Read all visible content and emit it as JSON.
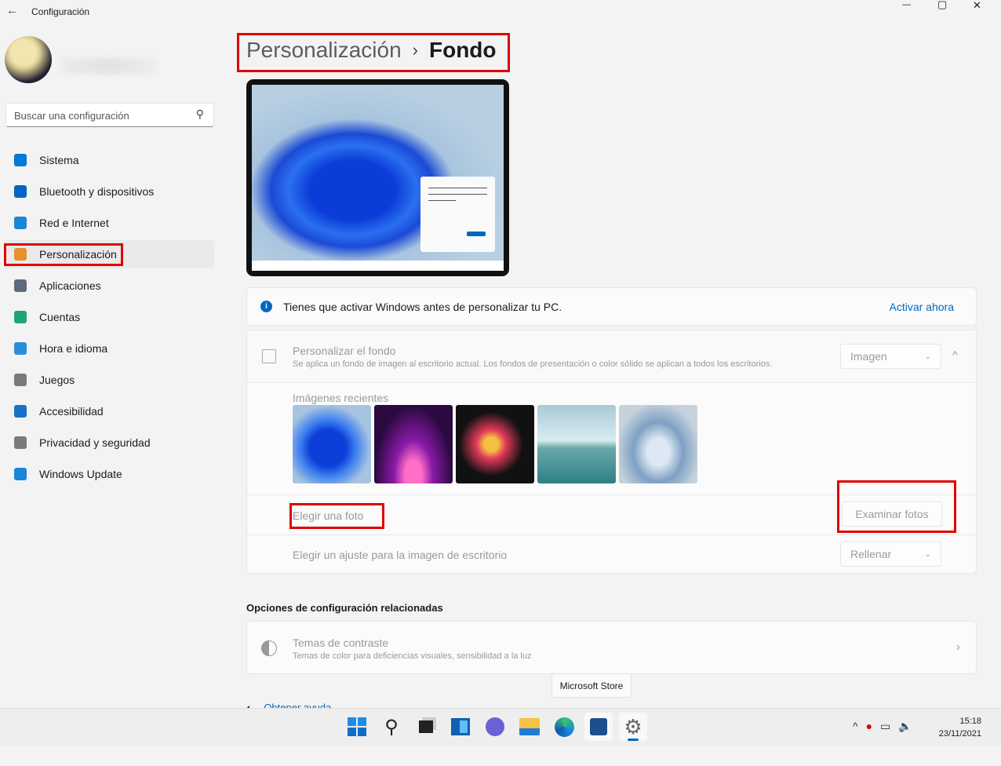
{
  "window": {
    "title": "Configuración",
    "back_icon": "arrow-left-icon",
    "minimize": "—",
    "maximize": "▢",
    "close": "✕"
  },
  "user": {
    "avatar": "avatar"
  },
  "search": {
    "placeholder": "Buscar una configuración",
    "icon": "search-icon"
  },
  "sidebar": {
    "items": [
      {
        "label": "Sistema",
        "icon": "monitor-icon",
        "color": "#0078d4"
      },
      {
        "label": "Bluetooth y dispositivos",
        "icon": "bluetooth-icon",
        "color": "#0067c0"
      },
      {
        "label": "Red e Internet",
        "icon": "wifi-icon",
        "color": "#1a86d8"
      },
      {
        "label": "Personalización",
        "icon": "brush-icon",
        "color": "#e8912d",
        "selected": true
      },
      {
        "label": "Aplicaciones",
        "icon": "apps-icon",
        "color": "#5b6b7c"
      },
      {
        "label": "Cuentas",
        "icon": "person-icon",
        "color": "#1fa37a"
      },
      {
        "label": "Hora e idioma",
        "icon": "clock-globe-icon",
        "color": "#2a8fd8"
      },
      {
        "label": "Juegos",
        "icon": "gamepad-icon",
        "color": "#7a7a7a"
      },
      {
        "label": "Accesibilidad",
        "icon": "accessibility-icon",
        "color": "#1673c9"
      },
      {
        "label": "Privacidad y seguridad",
        "icon": "shield-icon",
        "color": "#7a7a7a"
      },
      {
        "label": "Windows Update",
        "icon": "update-icon",
        "color": "#1a86d8"
      }
    ]
  },
  "breadcrumb": {
    "parent": "Personalización",
    "separator": "›",
    "current": "Fondo"
  },
  "info": {
    "text": "Tienes que activar Windows antes de personalizar tu PC.",
    "link": "Activar ahora",
    "icon": "info-icon"
  },
  "background": {
    "title": "Personalizar el fondo",
    "description": "Se aplica un fondo de imagen al escritorio actual. Los fondos de presentación o color sólido se aplican a todos los escritorios.",
    "type_value": "Imagen",
    "recent_label": "Imágenes recientes",
    "choose_photo": "Elegir una foto",
    "browse_button": "Examinar fotos",
    "fit_label": "Elegir un ajuste para la imagen de escritorio",
    "fit_value": "Rellenar"
  },
  "related": {
    "heading": "Opciones de configuración relacionadas",
    "title": "Temas de contraste",
    "description": "Temas de color para deficiencias visuales, sensibilidad a la luz"
  },
  "help": {
    "label": "Obtener ayuda"
  },
  "tooltip": "Microsoft Store",
  "taskbar": {
    "icons": [
      "start-icon",
      "search-icon",
      "task-view-icon",
      "widgets-icon",
      "chat-icon",
      "file-explorer-icon",
      "edge-icon",
      "store-icon",
      "settings-icon"
    ],
    "time": "15:18",
    "date": "23/11/2021"
  },
  "accent": "#0067c0"
}
